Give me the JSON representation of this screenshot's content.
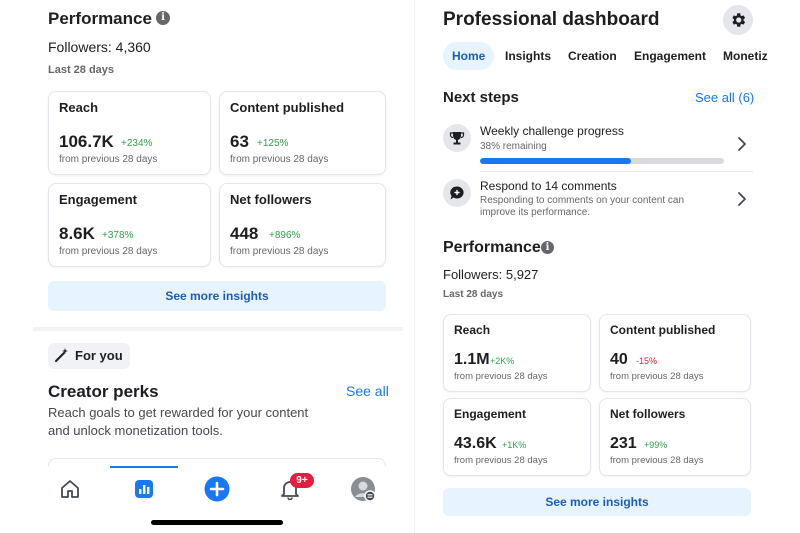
{
  "left": {
    "performance_title": "Performance",
    "info_glyph": "i",
    "followers": "Followers: 4,360",
    "period": "Last 28 days",
    "cards": [
      {
        "label": "Reach",
        "value": "106.7K",
        "delta": "+234%",
        "trend": "positive",
        "sub": "from previous 28 days"
      },
      {
        "label": "Content published",
        "value": "63",
        "delta": "+125%",
        "trend": "positive",
        "sub": "from previous 28 days"
      },
      {
        "label": "Engagement",
        "value": "8.6K",
        "delta": "+378%",
        "trend": "positive",
        "sub": "from previous 28 days"
      },
      {
        "label": "Net followers",
        "value": "448",
        "delta": "+896%",
        "trend": "positive",
        "sub": "from previous 28 days"
      }
    ],
    "see_more": "See more insights",
    "for_you": "For you",
    "perks_title": "Creator perks",
    "perks_see_all": "See all",
    "perks_desc_line1": "Reach goals to get rewarded for your content",
    "perks_desc_line2": "and unlock monetization tools.",
    "nav": {
      "items": [
        "home-icon",
        "insights-icon",
        "create-icon",
        "notifications-icon",
        "profile-icon"
      ],
      "notification_badge": "9+"
    }
  },
  "right": {
    "title": "Professional dashboard",
    "tabs": [
      "Home",
      "Insights",
      "Creation",
      "Engagement",
      "Monetiz"
    ],
    "active_tab": "Home",
    "next_steps_title": "Next steps",
    "next_steps_see_all": "See all (6)",
    "steps": [
      {
        "icon": "trophy-icon",
        "title": "Weekly challenge progress",
        "sub": "38% remaining",
        "progress": 0.62
      },
      {
        "icon": "comment-icon",
        "title": "Respond to 14 comments",
        "sub_line1": "Responding to comments on your content can",
        "sub_line2": "improve its performance."
      }
    ],
    "performance_title": "Performance",
    "info_glyph": "i",
    "followers": "Followers: 5,927",
    "period": "Last 28 days",
    "cards": [
      {
        "label": "Reach",
        "value": "1.1M",
        "delta": "+2K%",
        "trend": "positive",
        "sub": "from previous 28 days"
      },
      {
        "label": "Content published",
        "value": "40",
        "delta": "-15%",
        "trend": "negative",
        "sub": "from previous 28 days"
      },
      {
        "label": "Engagement",
        "value": "43.6K",
        "delta": "+1K%",
        "trend": "positive",
        "sub": "from previous 28 days"
      },
      {
        "label": "Net followers",
        "value": "231",
        "delta": "+99%",
        "trend": "positive",
        "sub": "from previous 28 days"
      }
    ],
    "see_more": "See more insights"
  },
  "colors": {
    "accent": "#1877f2",
    "positive": "#31a24c",
    "negative": "#e41e3f",
    "button_bg": "#e7f3ff"
  }
}
